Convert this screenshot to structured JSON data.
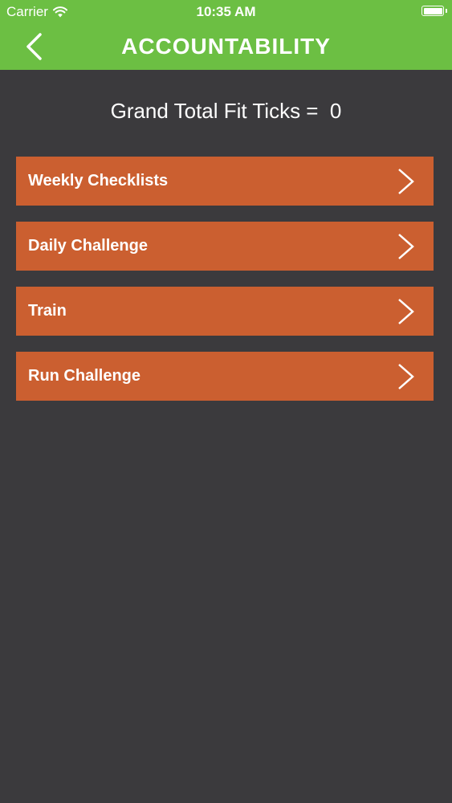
{
  "status_bar": {
    "carrier": "Carrier",
    "time": "10:35 AM",
    "battery_level": 1.0
  },
  "nav": {
    "title": "ACCOUNTABILITY",
    "back_icon": "chevron-left-icon"
  },
  "grand_total": {
    "text": "Grand Total Fit Ticks =  0"
  },
  "menu": {
    "items": [
      {
        "label": "Weekly Checklists"
      },
      {
        "label": "Daily Challenge"
      },
      {
        "label": "Train"
      },
      {
        "label": "Run Challenge"
      }
    ]
  },
  "colors": {
    "nav_green": "#6cbf43",
    "background": "#3b3a3d",
    "item_orange": "#cb5f30",
    "text": "#ffffff"
  }
}
